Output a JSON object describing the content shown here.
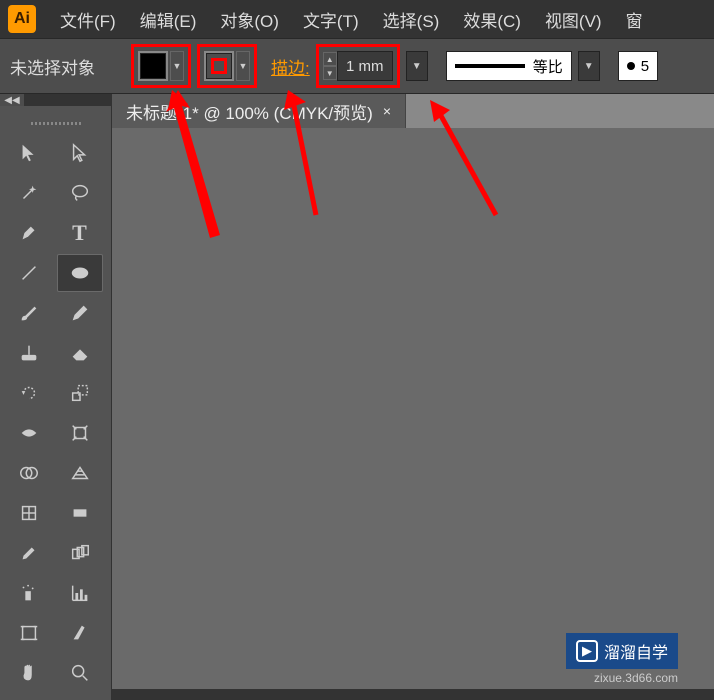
{
  "app_logo": "Ai",
  "menu": {
    "file": "文件(F)",
    "edit": "编辑(E)",
    "object": "对象(O)",
    "type": "文字(T)",
    "select": "选择(S)",
    "effect": "效果(C)",
    "view": "视图(V)",
    "window": "窗"
  },
  "options": {
    "selection_label": "未选择对象",
    "stroke_label": "描边:",
    "stroke_weight": "1 mm",
    "stroke_style": "等比",
    "brush_size": "5"
  },
  "tab": {
    "title": "未标题-1* @ 100% (CMYK/预览)",
    "close": "×"
  },
  "collapse_icon": "◀◀",
  "watermark": {
    "text": "溜溜自学",
    "sub": "zixue.3d66.com",
    "icon": "▶"
  }
}
